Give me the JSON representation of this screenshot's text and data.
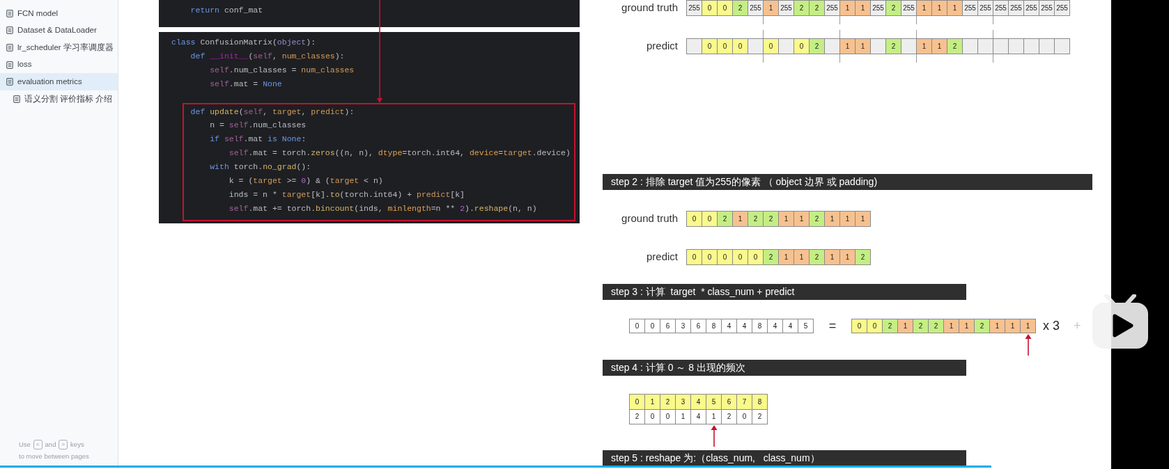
{
  "sidebar": {
    "items": [
      {
        "label": "FCN model",
        "selected": false
      },
      {
        "label": "Dataset & DataLoader",
        "selected": false
      },
      {
        "label": "lr_scheduler 学习率调度器",
        "selected": false
      },
      {
        "label": "loss",
        "selected": false
      },
      {
        "label": "evaluation metrics",
        "selected": true,
        "children": [
          {
            "label": "语义分割 评价指标 介绍",
            "selected": false
          }
        ]
      }
    ],
    "hint": {
      "before": "Use",
      "key_prev": "<",
      "middle": "and",
      "key_next": ">",
      "after": "keys",
      "line2": "to move between pages"
    }
  },
  "code": {
    "panels": [
      {
        "lines": [
          {
            "tokens": [
              {
                "text": "    return",
                "kind": "kw"
              },
              {
                "text": " conf_mat",
                "kind": "plain"
              }
            ]
          }
        ]
      },
      {
        "lines": [
          {
            "tokens": [
              {
                "text": "class",
                "kind": "kw"
              },
              {
                "text": " ConfusionMatrix(",
                "kind": "plain"
              },
              {
                "text": "object",
                "kind": "builtin"
              },
              {
                "text": "):",
                "kind": "plain"
              }
            ]
          },
          {
            "tokens": [
              {
                "text": "    def",
                "kind": "kw"
              },
              {
                "text": " __init__",
                "kind": "magic"
              },
              {
                "text": "(",
                "kind": "plain"
              },
              {
                "text": "self",
                "kind": "self"
              },
              {
                "text": ", ",
                "kind": "plain"
              },
              {
                "text": "num_classes",
                "kind": "param"
              },
              {
                "text": "):",
                "kind": "plain"
              }
            ]
          },
          {
            "tokens": [
              {
                "text": "        self",
                "kind": "self"
              },
              {
                "text": ".num_classes = ",
                "kind": "plain"
              },
              {
                "text": "num_classes",
                "kind": "param"
              }
            ]
          },
          {
            "tokens": [
              {
                "text": "        self",
                "kind": "self"
              },
              {
                "text": ".mat = ",
                "kind": "plain"
              },
              {
                "text": "None",
                "kind": "kw"
              }
            ]
          }
        ],
        "highlight": {
          "arrow": true,
          "lines": [
            {
              "tokens": [
                {
                  "text": "    def",
                  "kind": "kw"
                },
                {
                  "text": " update",
                  "kind": "fn"
                },
                {
                  "text": "(",
                  "kind": "plain"
                },
                {
                  "text": "self",
                  "kind": "self"
                },
                {
                  "text": ", ",
                  "kind": "plain"
                },
                {
                  "text": "target",
                  "kind": "param"
                },
                {
                  "text": ", ",
                  "kind": "plain"
                },
                {
                  "text": "predict",
                  "kind": "param"
                },
                {
                  "text": "):",
                  "kind": "plain"
                }
              ]
            },
            {
              "tokens": [
                {
                  "text": "        n = ",
                  "kind": "plain"
                },
                {
                  "text": "self",
                  "kind": "self"
                },
                {
                  "text": ".num_classes",
                  "kind": "plain"
                }
              ]
            },
            {
              "tokens": [
                {
                  "text": "        if",
                  "kind": "kw"
                },
                {
                  "text": " self",
                  "kind": "self"
                },
                {
                  "text": ".mat ",
                  "kind": "plain"
                },
                {
                  "text": "is",
                  "kind": "kw"
                },
                {
                  "text": " None",
                  "kind": "kw"
                },
                {
                  "text": ":",
                  "kind": "plain"
                }
              ]
            },
            {
              "tokens": [
                {
                  "text": "            self",
                  "kind": "self"
                },
                {
                  "text": ".mat = torch.",
                  "kind": "plain"
                },
                {
                  "text": "zeros",
                  "kind": "fn"
                },
                {
                  "text": "((n, n), ",
                  "kind": "plain"
                },
                {
                  "text": "dtype",
                  "kind": "kwarg"
                },
                {
                  "text": "=torch.int64, ",
                  "kind": "plain"
                },
                {
                  "text": "device",
                  "kind": "kwarg"
                },
                {
                  "text": "=",
                  "kind": "plain"
                },
                {
                  "text": "target",
                  "kind": "param"
                },
                {
                  "text": ".device)",
                  "kind": "plain"
                }
              ]
            },
            {
              "tokens": [
                {
                  "text": "        with",
                  "kind": "kw"
                },
                {
                  "text": " torch.",
                  "kind": "plain"
                },
                {
                  "text": "no_grad",
                  "kind": "fn"
                },
                {
                  "text": "():",
                  "kind": "plain"
                }
              ]
            },
            {
              "tokens": [
                {
                  "text": "            k = (",
                  "kind": "plain"
                },
                {
                  "text": "target",
                  "kind": "param"
                },
                {
                  "text": " >= ",
                  "kind": "plain"
                },
                {
                  "text": "0",
                  "kind": "num"
                },
                {
                  "text": ") & (",
                  "kind": "plain"
                },
                {
                  "text": "target",
                  "kind": "param"
                },
                {
                  "text": " < n)",
                  "kind": "plain"
                }
              ]
            },
            {
              "tokens": [
                {
                  "text": "            inds = n * ",
                  "kind": "plain"
                },
                {
                  "text": "target",
                  "kind": "param"
                },
                {
                  "text": "[k].",
                  "kind": "plain"
                },
                {
                  "text": "to",
                  "kind": "fn"
                },
                {
                  "text": "(torch.int64) + ",
                  "kind": "plain"
                },
                {
                  "text": "predict",
                  "kind": "param"
                },
                {
                  "text": "[k]",
                  "kind": "plain"
                }
              ]
            },
            {
              "tokens": [
                {
                  "text": "            self",
                  "kind": "self"
                },
                {
                  "text": ".mat += torch.",
                  "kind": "plain"
                },
                {
                  "text": "bincount",
                  "kind": "fn"
                },
                {
                  "text": "(inds, ",
                  "kind": "plain"
                },
                {
                  "text": "minlength",
                  "kind": "kwarg"
                },
                {
                  "text": "=n ** ",
                  "kind": "plain"
                },
                {
                  "text": "2",
                  "kind": "num"
                },
                {
                  "text": ").",
                  "kind": "plain"
                },
                {
                  "text": "reshape",
                  "kind": "fn"
                },
                {
                  "text": "(n, n)",
                  "kind": "plain"
                }
              ]
            }
          ]
        }
      }
    ]
  },
  "slide": {
    "intro_rows": [
      {
        "label": "ground truth",
        "cells": [
          {
            "text": "255",
            "color": "#eeeeee"
          },
          {
            "text": "0",
            "color": "#f9f98c"
          },
          {
            "text": "0",
            "color": "#f9f98c"
          },
          {
            "text": "2",
            "color": "#c4ee84"
          },
          {
            "text": "255",
            "color": "#eeeeee"
          },
          {
            "text": "1",
            "color": "#f7c18f"
          },
          {
            "text": "255",
            "color": "#eeeeee"
          },
          {
            "text": "2",
            "color": "#c4ee84"
          },
          {
            "text": "2",
            "color": "#c4ee84"
          },
          {
            "text": "255",
            "color": "#eeeeee"
          },
          {
            "text": "1",
            "color": "#f7c18f"
          },
          {
            "text": "1",
            "color": "#f7c18f"
          },
          {
            "text": "255",
            "color": "#eeeeee"
          },
          {
            "text": "2",
            "color": "#c4ee84"
          },
          {
            "text": "255",
            "color": "#eeeeee"
          },
          {
            "text": "1",
            "color": "#f7c18f"
          },
          {
            "text": "1",
            "color": "#f7c18f"
          },
          {
            "text": "1",
            "color": "#f7c18f"
          },
          {
            "text": "255",
            "color": "#eeeeee"
          },
          {
            "text": "255",
            "color": "#eeeeee"
          },
          {
            "text": "255",
            "color": "#eeeeee"
          },
          {
            "text": "255",
            "color": "#eeeeee"
          },
          {
            "text": "255",
            "color": "#eeeeee"
          },
          {
            "text": "255",
            "color": "#eeeeee"
          },
          {
            "text": "255",
            "color": "#eeeeee"
          }
        ]
      },
      {
        "label": "predict",
        "cells": [
          {
            "color": "#eeeeee"
          },
          {
            "text": "0",
            "color": "#f9f98c"
          },
          {
            "text": "0",
            "color": "#f9f98c"
          },
          {
            "text": "0",
            "color": "#f9f98c"
          },
          {
            "color": "#eeeeee"
          },
          {
            "text": "0",
            "color": "#f9f98c"
          },
          {
            "color": "#eeeeee"
          },
          {
            "text": "0",
            "color": "#f9f98c"
          },
          {
            "text": "2",
            "color": "#c4ee84"
          },
          {
            "color": "#eeeeee"
          },
          {
            "text": "1",
            "color": "#f7c18f"
          },
          {
            "text": "1",
            "color": "#f7c18f"
          },
          {
            "color": "#eeeeee"
          },
          {
            "text": "2",
            "color": "#c4ee84"
          },
          {
            "color": "#eeeeee"
          },
          {
            "text": "1",
            "color": "#f7c18f"
          },
          {
            "text": "1",
            "color": "#f7c18f"
          },
          {
            "text": "2",
            "color": "#c4ee84"
          },
          {
            "color": "#eeeeee"
          },
          {
            "color": "#eeeeee"
          },
          {
            "color": "#eeeeee"
          },
          {
            "color": "#eeeeee"
          },
          {
            "color": "#eeeeee"
          },
          {
            "color": "#eeeeee"
          },
          {
            "color": "#eeeeee"
          }
        ]
      }
    ],
    "steps": [
      {
        "kind": "rows",
        "wide": true,
        "title": "step 2 : 排除 target 值为255的像素 （ object 边界 或 padding)",
        "rows": [
          {
            "label": "ground truth",
            "cells": [
              {
                "text": "0",
                "color": "#f9f98c"
              },
              {
                "text": "0",
                "color": "#f9f98c"
              },
              {
                "text": "2",
                "color": "#c4ee84"
              },
              {
                "text": "1",
                "color": "#f7c18f"
              },
              {
                "text": "2",
                "color": "#c4ee84"
              },
              {
                "text": "2",
                "color": "#c4ee84"
              },
              {
                "text": "1",
                "color": "#f7c18f"
              },
              {
                "text": "1",
                "color": "#f7c18f"
              },
              {
                "text": "2",
                "color": "#c4ee84"
              },
              {
                "text": "1",
                "color": "#f7c18f"
              },
              {
                "text": "1",
                "color": "#f7c18f"
              },
              {
                "text": "1",
                "color": "#f7c18f"
              }
            ]
          },
          {
            "label": "predict",
            "cells": [
              {
                "text": "0",
                "color": "#f9f98c"
              },
              {
                "text": "0",
                "color": "#f9f98c"
              },
              {
                "text": "0",
                "color": "#f9f98c"
              },
              {
                "text": "0",
                "color": "#f9f98c"
              },
              {
                "text": "0",
                "color": "#f9f98c"
              },
              {
                "text": "2",
                "color": "#c4ee84"
              },
              {
                "text": "1",
                "color": "#f7c18f"
              },
              {
                "text": "1",
                "color": "#f7c18f"
              },
              {
                "text": "2",
                "color": "#c4ee84"
              },
              {
                "text": "1",
                "color": "#f7c18f"
              },
              {
                "text": "1",
                "color": "#f7c18f"
              },
              {
                "text": "2",
                "color": "#c4ee84"
              }
            ]
          }
        ]
      },
      {
        "kind": "equation",
        "wide": false,
        "title": "step 3 : 计算  target  * class_num + predict",
        "sum_cells": [
          {
            "text": "0",
            "color": "#ffffff"
          },
          {
            "text": "0",
            "color": "#ffffff"
          },
          {
            "text": "6",
            "color": "#ffffff"
          },
          {
            "text": "3",
            "color": "#ffffff"
          },
          {
            "text": "6",
            "color": "#ffffff"
          },
          {
            "text": "8",
            "color": "#ffffff"
          },
          {
            "text": "4",
            "color": "#ffffff"
          },
          {
            "text": "4",
            "color": "#ffffff"
          },
          {
            "text": "8",
            "color": "#ffffff"
          },
          {
            "text": "4",
            "color": "#ffffff"
          },
          {
            "text": "4",
            "color": "#ffffff"
          },
          {
            "text": "5",
            "color": "#ffffff"
          }
        ],
        "equals": "=",
        "target_cells": [
          {
            "text": "0",
            "color": "#f9f98c",
            "arrow": false
          },
          {
            "text": "0",
            "color": "#f9f98c",
            "arrow": false
          },
          {
            "text": "2",
            "color": "#c4ee84",
            "arrow": false
          },
          {
            "text": "1",
            "color": "#f7c18f",
            "arrow": false
          },
          {
            "text": "2",
            "color": "#c4ee84",
            "arrow": false
          },
          {
            "text": "2",
            "color": "#c4ee84",
            "arrow": false
          },
          {
            "text": "1",
            "color": "#f7c18f",
            "arrow": false
          },
          {
            "text": "1",
            "color": "#f7c18f",
            "arrow": false
          },
          {
            "text": "2",
            "color": "#c4ee84",
            "arrow": false
          },
          {
            "text": "1",
            "color": "#f7c18f",
            "arrow": false
          },
          {
            "text": "1",
            "color": "#f7c18f",
            "arrow": false
          },
          {
            "text": "1",
            "color": "#f7c18f",
            "arrow": true
          }
        ],
        "multiplier": "x 3",
        "plus": "+"
      },
      {
        "kind": "table",
        "wide": false,
        "title": "step 4 : 计算 0 ～ 8 出现的频次",
        "header_cells": [
          {
            "text": "0",
            "color": "#f9f98c"
          },
          {
            "text": "1",
            "color": "#f9f98c"
          },
          {
            "text": "2",
            "color": "#f9f98c"
          },
          {
            "text": "3",
            "color": "#f9f98c"
          },
          {
            "text": "4",
            "color": "#f9f98c"
          },
          {
            "text": "5",
            "color": "#f9f98c"
          },
          {
            "text": "6",
            "color": "#f9f98c"
          },
          {
            "text": "7",
            "color": "#f9f98c"
          },
          {
            "text": "8",
            "color": "#f9f98c"
          }
        ],
        "value_cells": [
          {
            "text": "2",
            "color": "#ffffff",
            "arrow": false
          },
          {
            "text": "0",
            "color": "#ffffff",
            "arrow": false
          },
          {
            "text": "0",
            "color": "#ffffff",
            "arrow": false
          },
          {
            "text": "1",
            "color": "#ffffff",
            "arrow": false
          },
          {
            "text": "4",
            "color": "#ffffff",
            "arrow": false
          },
          {
            "text": "1",
            "color": "#ffffff",
            "arrow": true
          },
          {
            "text": "2",
            "color": "#ffffff",
            "arrow": false
          },
          {
            "text": "0",
            "color": "#ffffff",
            "arrow": false
          },
          {
            "text": "2",
            "color": "#ffffff",
            "arrow": false
          }
        ]
      },
      {
        "kind": "header",
        "wide": false,
        "title": "step 5 : reshape 为:（class_num,   class_num）"
      }
    ]
  },
  "video": {
    "progress": {
      "level": 0.848
    }
  }
}
